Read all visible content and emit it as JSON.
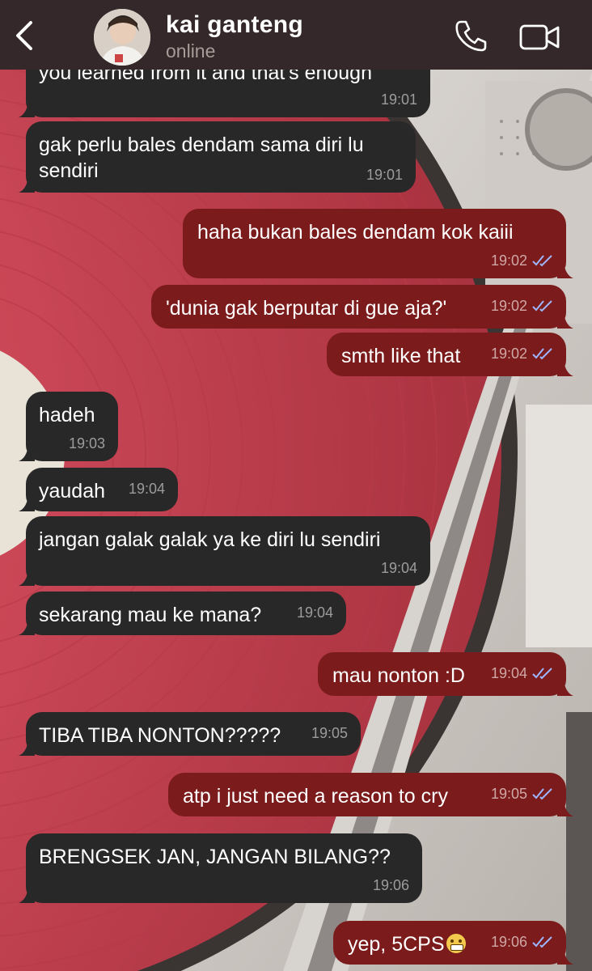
{
  "header": {
    "contact_name": "kai ganteng",
    "status": "online"
  },
  "icons": {
    "back": "chevron-left-icon",
    "call": "phone-icon",
    "video": "video-camera-icon",
    "read_receipt": "double-check-icon"
  },
  "colors": {
    "header_bg": "#34282a",
    "incoming_bubble": "#272827",
    "outgoing_bubble": "#7b1b1b",
    "read_ticks": "#9eb6ff"
  },
  "messages": [
    {
      "dir": "in",
      "text": "you learned from it and that's enough",
      "time": "19:01"
    },
    {
      "dir": "in",
      "text": "gak perlu bales dendam sama diri lu sendiri",
      "time": "19:01"
    },
    {
      "dir": "out",
      "text": "haha bukan bales dendam kok kaiii",
      "time": "19:02",
      "read": true
    },
    {
      "dir": "out",
      "text": "'dunia gak berputar di gue aja?'",
      "time": "19:02",
      "read": true
    },
    {
      "dir": "out",
      "text": "smth like that",
      "time": "19:02",
      "read": true
    },
    {
      "dir": "in",
      "text": "hadeh",
      "time": "19:03"
    },
    {
      "dir": "in",
      "text": "yaudah",
      "time": "19:04"
    },
    {
      "dir": "in",
      "text": "jangan galak galak ya ke diri lu sendiri",
      "time": "19:04"
    },
    {
      "dir": "in",
      "text": "sekarang mau ke mana?",
      "time": "19:04"
    },
    {
      "dir": "out",
      "text": "mau nonton :D",
      "time": "19:04",
      "read": true
    },
    {
      "dir": "in",
      "text": "TIBA TIBA NONTON?????",
      "time": "19:05"
    },
    {
      "dir": "out",
      "text": "atp i just need a reason to cry",
      "time": "19:05",
      "read": true
    },
    {
      "dir": "in",
      "text": "BRENGSEK JAN, JANGAN BILANG??",
      "time": "19:06"
    },
    {
      "dir": "out",
      "text": "yep, 5CPS",
      "emoji": "grimacing-face",
      "time": "19:06",
      "read": true
    }
  ]
}
